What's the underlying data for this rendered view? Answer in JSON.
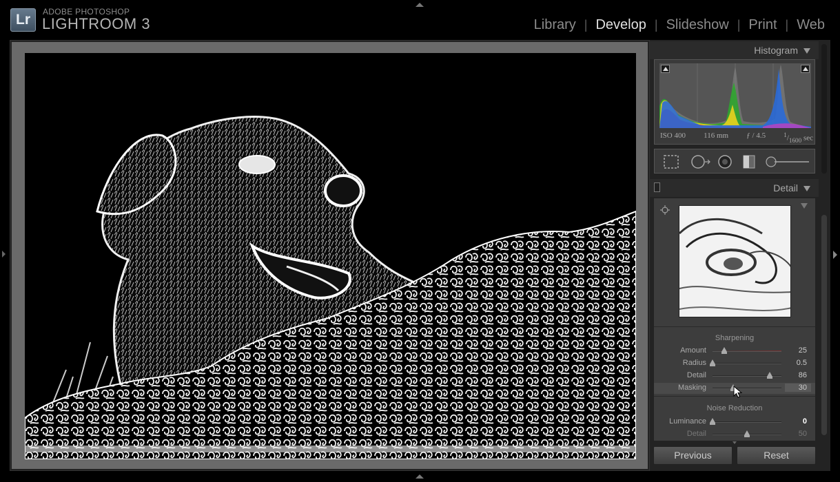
{
  "app": {
    "logo_text": "Lr",
    "brand_line1": "ADOBE PHOTOSHOP",
    "brand_line2": "LIGHTROOM 3"
  },
  "modules": [
    {
      "label": "Library",
      "active": false
    },
    {
      "label": "Develop",
      "active": true
    },
    {
      "label": "Slideshow",
      "active": false
    },
    {
      "label": "Print",
      "active": false
    },
    {
      "label": "Web",
      "active": false
    }
  ],
  "histogram": {
    "title": "Histogram",
    "iso": "ISO 400",
    "focal": "116 mm",
    "aperture": "ƒ / 4.5",
    "shutter_num": "1",
    "shutter_den": "1600",
    "shutter_unit": "sec"
  },
  "tools": [
    "crop-overlay-tool",
    "spot-removal-tool",
    "red-eye-tool",
    "graduated-filter-tool",
    "adjustment-brush-tool"
  ],
  "detail": {
    "title": "Detail",
    "sharpening": {
      "title": "Sharpening",
      "sliders": [
        {
          "label": "Amount",
          "value": "25",
          "position": 0.17
        },
        {
          "label": "Radius",
          "value": "0.5",
          "position": 0.0
        },
        {
          "label": "Detail",
          "value": "86",
          "position": 0.83
        },
        {
          "label": "Masking",
          "value": "30",
          "position": 0.3
        }
      ]
    },
    "noise_reduction": {
      "title": "Noise Reduction",
      "sliders": [
        {
          "label": "Luminance",
          "value": "0",
          "position": 0.0
        },
        {
          "label": "Detail",
          "value": "50",
          "position": 0.5
        }
      ]
    }
  },
  "buttons": {
    "previous": "Previous",
    "reset": "Reset"
  },
  "colors": {
    "app_bg": "#000000",
    "panel_bg": "#232323",
    "active_module": "#e0e0e0",
    "inactive_module": "#8c8c8c"
  }
}
